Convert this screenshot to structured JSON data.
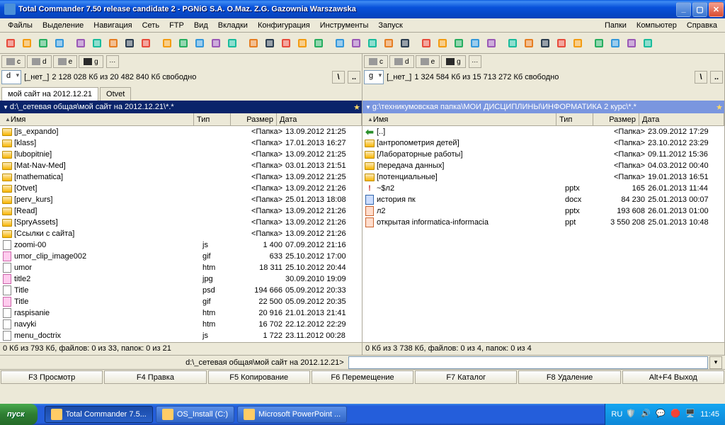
{
  "window": {
    "title": "Total Commander 7.50 release candidate 2 - PGNiG S.A. O.Maz. Z.G. Gazownia Warszawska"
  },
  "menu": {
    "left": [
      "Файлы",
      "Выделение",
      "Навигация",
      "Сеть",
      "FTP",
      "Вид",
      "Вкладки",
      "Конфигурация",
      "Инструменты",
      "Запуск"
    ],
    "right": [
      "Папки",
      "Компьютер",
      "Справка"
    ]
  },
  "drives": [
    "c",
    "d",
    "e",
    "g"
  ],
  "left": {
    "drive": "d",
    "label": "[_нет_]",
    "free": "2 128 028 Кб из 20 482 840 Кб свободно",
    "tabs": [
      "мой сайт на 2012.12.21",
      "Otvet"
    ],
    "activeTab": 0,
    "path": "d:\\_сетевая общая\\мой сайт на 2012.12.21\\*.*",
    "cols": [
      "Имя",
      "Тип",
      "Размер",
      "Дата"
    ],
    "rows": [
      {
        "n": "[js_expando]",
        "t": "",
        "s": "<Папка>",
        "d": "13.09.2012 21:25",
        "k": "fld"
      },
      {
        "n": "[klass]",
        "t": "",
        "s": "<Папка>",
        "d": "17.01.2013 16:27",
        "k": "fld"
      },
      {
        "n": "[lubopitnie]",
        "t": "",
        "s": "<Папка>",
        "d": "13.09.2012 21:25",
        "k": "fld"
      },
      {
        "n": "[Mat-Nav-Med]",
        "t": "",
        "s": "<Папка>",
        "d": "03.01.2013 21:51",
        "k": "fld"
      },
      {
        "n": "[mathematica]",
        "t": "",
        "s": "<Папка>",
        "d": "13.09.2012 21:25",
        "k": "fld"
      },
      {
        "n": "[Otvet]",
        "t": "",
        "s": "<Папка>",
        "d": "13.09.2012 21:26",
        "k": "fld"
      },
      {
        "n": "[perv_kurs]",
        "t": "",
        "s": "<Папка>",
        "d": "25.01.2013 18:08",
        "k": "fld"
      },
      {
        "n": "[Read]",
        "t": "",
        "s": "<Папка>",
        "d": "13.09.2012 21:26",
        "k": "fld"
      },
      {
        "n": "[SpryAssets]",
        "t": "",
        "s": "<Папка>",
        "d": "13.09.2012 21:26",
        "k": "fld"
      },
      {
        "n": "[Ссылки с сайта]",
        "t": "",
        "s": "<Папка>",
        "d": "13.09.2012 21:26",
        "k": "fld"
      },
      {
        "n": "zoomi-00",
        "t": "js",
        "s": "1 400",
        "d": "07.09.2012 21:16",
        "k": "file"
      },
      {
        "n": "umor_clip_image002",
        "t": "gif",
        "s": "633",
        "d": "25.10.2012 17:00",
        "k": "img"
      },
      {
        "n": "umor",
        "t": "htm",
        "s": "18 311",
        "d": "25.10.2012 20:44",
        "k": "file"
      },
      {
        "n": "title2",
        "t": "jpg",
        "s": "",
        "d": "30.09.2010 19:09",
        "k": "img"
      },
      {
        "n": "Title",
        "t": "psd",
        "s": "194 666",
        "d": "05.09.2012 20:33",
        "k": "file"
      },
      {
        "n": "Title",
        "t": "gif",
        "s": "22 500",
        "d": "05.09.2012 20:35",
        "k": "img"
      },
      {
        "n": "raspisanie",
        "t": "htm",
        "s": "20 916",
        "d": "21.01.2013 21:41",
        "k": "file"
      },
      {
        "n": "navyki",
        "t": "htm",
        "s": "16 702",
        "d": "22.12.2012 22:29",
        "k": "file"
      },
      {
        "n": "menu_doctrix",
        "t": "js",
        "s": "1 722",
        "d": "23.11.2012 00:28",
        "k": "file"
      }
    ],
    "status": "0 Кб из 793 Кб, файлов: 0 из 33, папок: 0 из 21"
  },
  "right": {
    "drive": "g",
    "label": "[_нет_]",
    "free": "1 324 584 Кб из 15 713 272 Кб свободно",
    "path": "g:\\техникумовская папка\\МОИ ДИСЦИПЛИНЫ\\ИНФОРМАТИКА 2 курс\\*.*",
    "cols": [
      "Имя",
      "Тип",
      "Размер",
      "Дата"
    ],
    "rows": [
      {
        "n": "[..]",
        "t": "",
        "s": "<Папка>",
        "d": "23.09.2012 17:29",
        "k": "up"
      },
      {
        "n": "[антропометрия детей]",
        "t": "",
        "s": "<Папка>",
        "d": "23.10.2012 23:29",
        "k": "fld"
      },
      {
        "n": "[Лабораторные работы]",
        "t": "",
        "s": "<Папка>",
        "d": "09.11.2012 15:36",
        "k": "fld"
      },
      {
        "n": "[передача данных]",
        "t": "",
        "s": "<Папка>",
        "d": "04.03.2012 00:40",
        "k": "fld"
      },
      {
        "n": "[потенциальные]",
        "t": "",
        "s": "<Папка>",
        "d": "19.01.2013 16:51",
        "k": "fld"
      },
      {
        "n": "~$л2",
        "t": "pptx",
        "s": "165",
        "d": "26.01.2013 11:44",
        "k": "tmp"
      },
      {
        "n": "история пк",
        "t": "docx",
        "s": "84 230",
        "d": "25.01.2013 00:07",
        "k": "doc"
      },
      {
        "n": "л2",
        "t": "pptx",
        "s": "193 608",
        "d": "26.01.2013 01:00",
        "k": "ppt"
      },
      {
        "n": "открытая informatica-informacia",
        "t": "ppt",
        "s": "3 550 208",
        "d": "25.01.2013 10:48",
        "k": "ppt"
      }
    ],
    "status": "0 Кб из 3 738 Кб, файлов: 0 из 4, папок: 0 из 4"
  },
  "cmd": {
    "label": "d:\\_сетевая общая\\мой сайт на 2012.12.21>"
  },
  "fnkeys": [
    "F3 Просмотр",
    "F4 Правка",
    "F5 Копирование",
    "F6 Перемещение",
    "F7 Каталог",
    "F8 Удаление",
    "Alt+F4 Выход"
  ],
  "taskbar": {
    "start": "пуск",
    "items": [
      "Total Commander 7.5...",
      "OS_Install (C:)",
      "Microsoft PowerPoint ..."
    ],
    "lang": "RU",
    "clock": "11:45"
  }
}
